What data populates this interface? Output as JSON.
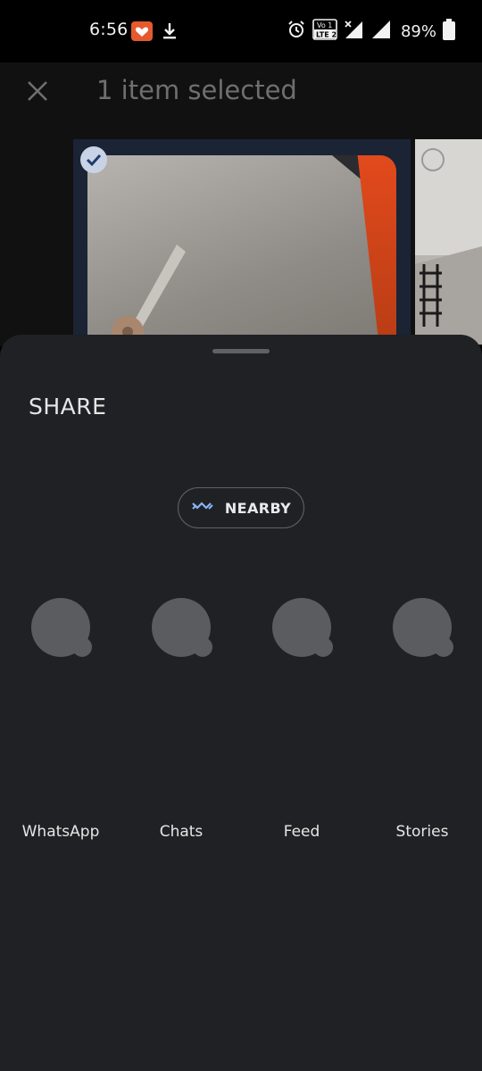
{
  "status_bar": {
    "time": "6:56",
    "battery_percent": "89%",
    "network_label": "LTE 2",
    "icons": [
      "heart-notification-icon",
      "download-icon",
      "alarm-icon",
      "volte-icon",
      "signal-icon",
      "signal-icon-2",
      "battery-icon"
    ]
  },
  "header": {
    "title": "1 item selected",
    "close_icon": "close-icon"
  },
  "gallery": {
    "items": [
      {
        "selected": true,
        "icon": "check-icon"
      },
      {
        "selected": false,
        "icon": "radio-unchecked-icon"
      }
    ]
  },
  "share_sheet": {
    "heading": "SHARE",
    "nearby_label": "NEARBY",
    "nearby_icon": "nearby-share-icon",
    "targets": [
      {
        "label": "WhatsApp"
      },
      {
        "label": "Chats"
      },
      {
        "label": "Feed"
      },
      {
        "label": "Stories"
      }
    ]
  },
  "colors": {
    "sheet_background": "#202124",
    "accent": "#8ab4f8",
    "text": "#e6e6e6",
    "muted_text": "#6f6f6f"
  }
}
